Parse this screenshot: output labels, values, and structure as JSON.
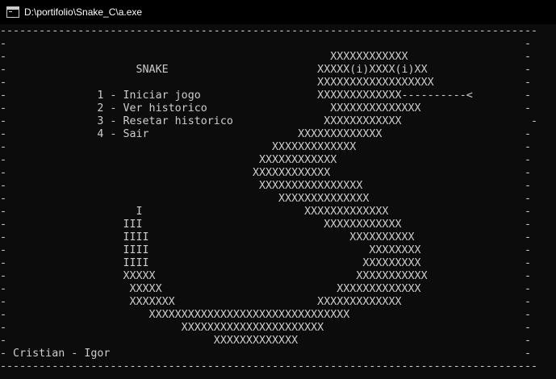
{
  "window": {
    "title": "D:\\portifolio\\Snake_C\\a.exe"
  },
  "console": {
    "lines": [
      "-----------------------------------------------------------------------------------",
      "-                                                                                -",
      "-                                                  XXXXXXXXXXXX                  -",
      "-                    SNAKE                       XXXXX(i)XXXX(i)XX               -",
      "-                                                XXXXXXXXXXXXXXXXXX              -",
      "-              1 - Iniciar jogo                  XXXXXXXXXXXXX----------<        -",
      "-              2 - Ver historico                   XXXXXXXXXXXXXX                -",
      "-              3 - Resetar historico              XXXXXXXXXXXX                    -",
      "-              4 - Sair                       XXXXXXXXXXXXX                      -",
      "-                                         XXXXXXXXXXXXX                          -",
      "-                                       XXXXXXXXXXXX                             -",
      "-                                      XXXXXXXXXXXX                              -",
      "-                                       XXXXXXXXXXXXXXXX                         -",
      "-                                          XXXXXXXXXXXXXX                        -",
      "-                    I                         XXXXXXXXXXXXX                     -",
      "-                  III                            XXXXXXXXXXXX                   -",
      "-                  IIII                               XXXXXXXXXX                 -",
      "-                  IIII                                  XXXXXXXX                -",
      "-                  IIII                                 XXXXXXXXX                -",
      "-                  XXXXX                               XXXXXXXXXXX               -",
      "-                   XXXXX                           XXXXXXXXXXXXX                -",
      "-                   XXXXXXX                      XXXXXXXXXXXXX                   -",
      "-                      XXXXXXXXXXXXXXXXXXXXXXXXXXXXXXX                           -",
      "-                           XXXXXXXXXXXXXXXXXXXXXX                               -",
      "-                                XXXXXXXXXXXXX                                   -",
      "- Cristian - Igor                                                                -",
      "-----------------------------------------------------------------------------------"
    ]
  }
}
